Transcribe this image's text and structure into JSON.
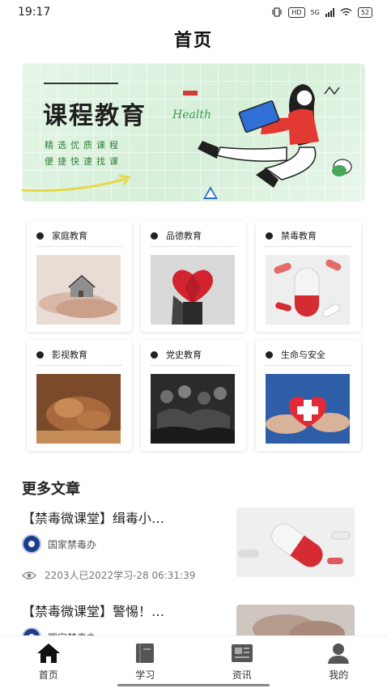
{
  "status_bar": {
    "time": "19:17",
    "hd": "HD",
    "network": "5G",
    "battery": "52"
  },
  "header": {
    "title": "首页"
  },
  "banner": {
    "title": "课程教育",
    "script_text": "Health",
    "sub_line1": "精选优质课程",
    "sub_line2": "便捷快速找课"
  },
  "categories": [
    {
      "label": "家庭教育",
      "image": "family-hands-house"
    },
    {
      "label": "品德教育",
      "image": "red-heart-hands"
    },
    {
      "label": "禁毒教育",
      "image": "pill-capsules"
    },
    {
      "label": "影视教育",
      "image": "clay-pottery-hands"
    },
    {
      "label": "党史教育",
      "image": "historical-crowd-photo"
    },
    {
      "label": "生命与安全",
      "image": "heart-first-aid"
    }
  ],
  "more_articles": {
    "title": "更多文章",
    "items": [
      {
        "title": "【禁毒微课堂】缉毒小…",
        "source": "国家禁毒办",
        "views": "2203人已",
        "date": "2022-08-28 06:31:39",
        "meta_overlap": "2203人已2022学习-28 06:31:39",
        "thumb": "capsule-pill"
      },
      {
        "title": "【禁毒微课堂】警惕！…",
        "source": "国家禁毒办",
        "thumb": "hands-photo"
      }
    ]
  },
  "tabbar": {
    "items": [
      {
        "label": "首页",
        "icon": "home-icon",
        "active": true
      },
      {
        "label": "学习",
        "icon": "book-icon",
        "active": false
      },
      {
        "label": "资讯",
        "icon": "news-icon",
        "active": false
      },
      {
        "label": "我的",
        "icon": "user-icon",
        "active": false
      }
    ]
  }
}
